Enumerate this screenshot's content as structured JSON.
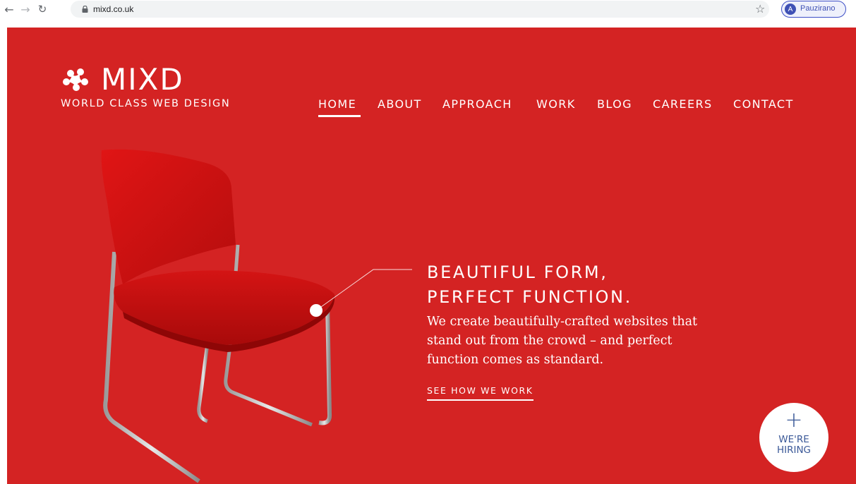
{
  "browser": {
    "url": "mixd.co.uk",
    "profile_initial": "A",
    "profile_name": "Pauzirano"
  },
  "site": {
    "logo_text": "MIXD",
    "tagline": "WORLD CLASS WEB DESIGN",
    "nav": [
      "HOME",
      "ABOUT",
      "APPROACH",
      "WORK",
      "BLOG",
      "CAREERS",
      "CONTACT"
    ],
    "active_nav": "HOME"
  },
  "hero": {
    "heading_line1": "BEAUTIFUL FORM,",
    "heading_line2": "PERFECT FUNCTION.",
    "body": "We create beautifully-crafted websites that stand out from the crowd – and perfect function comes as standard.",
    "cta": "SEE HOW WE WORK"
  },
  "hiring": {
    "symbol": "+",
    "line1": "WE'RE",
    "line2": "HIRING"
  },
  "colors": {
    "brand_red": "#d42323",
    "hiring_text": "#3b5998",
    "profile_accent": "#3f51b5"
  }
}
